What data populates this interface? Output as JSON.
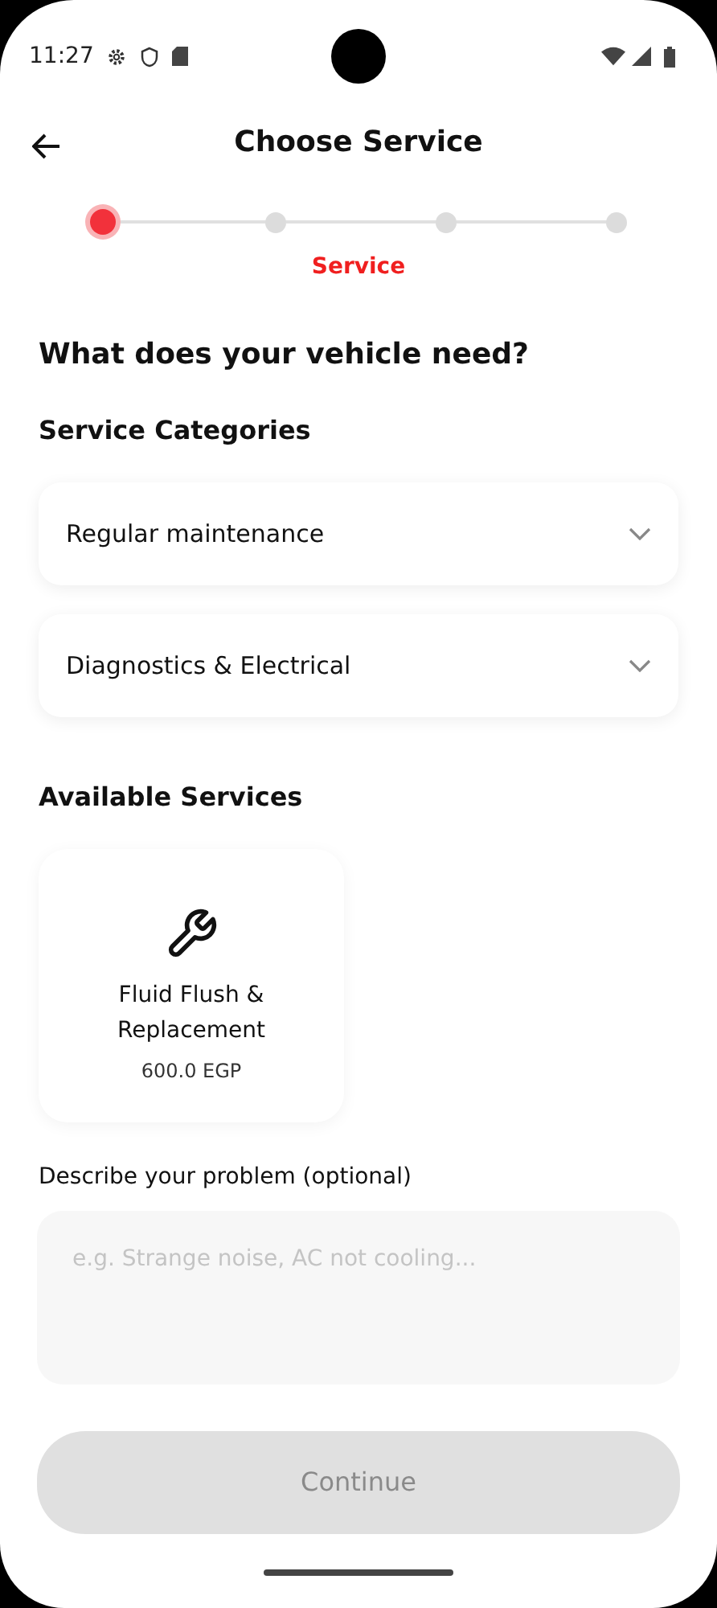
{
  "status_bar": {
    "time": "11:27"
  },
  "header": {
    "title": "Choose Service"
  },
  "stepper": {
    "steps": [
      {
        "selected": true
      },
      {
        "selected": false
      },
      {
        "selected": false
      },
      {
        "selected": false
      }
    ],
    "current_label": "Service"
  },
  "question": "What does your vehicle need?",
  "categories": {
    "title": "Service Categories",
    "items": [
      {
        "label": "Regular maintenance",
        "expanded": false
      },
      {
        "label": "Diagnostics & Electrical",
        "expanded": false
      }
    ]
  },
  "services": {
    "title": "Available Services",
    "items": [
      {
        "name": "Fluid Flush & Replacement",
        "price": "600.0 EGP"
      }
    ]
  },
  "description": {
    "label": "Describe your problem (optional)",
    "placeholder": "e.g. Strange noise, AC not cooling..."
  },
  "continue_button": {
    "label": "Continue",
    "disabled": true
  }
}
